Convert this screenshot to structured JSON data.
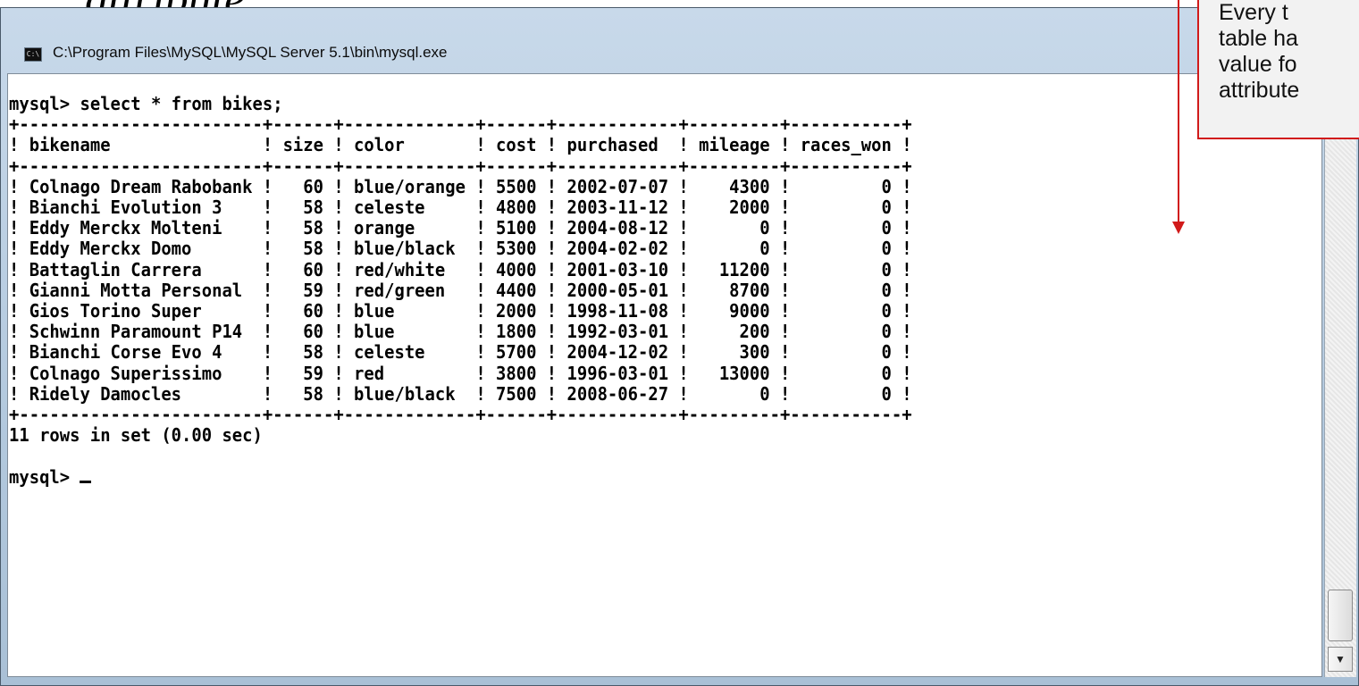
{
  "slide": {
    "title_fragment": "attribute."
  },
  "window": {
    "title": "C:\\Program Files\\MySQL\\MySQL Server 5.1\\bin\\mysql.exe",
    "icon": "console-icon",
    "minimize_icon": "minimize-icon"
  },
  "query": "mysql> select * from bikes;",
  "table": {
    "columns": [
      "bikename",
      "size",
      "color",
      "cost",
      "purchased",
      "mileage",
      "races_won"
    ],
    "rows": [
      [
        "Colnago Dream Rabobank",
        "60",
        "blue/orange",
        "5500",
        "2002-07-07",
        "4300",
        "0"
      ],
      [
        "Bianchi Evolution 3",
        "58",
        "celeste",
        "4800",
        "2003-11-12",
        "2000",
        "0"
      ],
      [
        "Eddy Merckx Molteni",
        "58",
        "orange",
        "5100",
        "2004-08-12",
        "0",
        "0"
      ],
      [
        "Eddy Merckx Domo",
        "58",
        "blue/black",
        "5300",
        "2004-02-02",
        "0",
        "0"
      ],
      [
        "Battaglin Carrera",
        "60",
        "red/white",
        "4000",
        "2001-03-10",
        "11200",
        "0"
      ],
      [
        "Gianni Motta Personal",
        "59",
        "red/green",
        "4400",
        "2000-05-01",
        "8700",
        "0"
      ],
      [
        "Gios Torino Super",
        "60",
        "blue",
        "2000",
        "1998-11-08",
        "9000",
        "0"
      ],
      [
        "Schwinn Paramount P14",
        "60",
        "blue",
        "1800",
        "1992-03-01",
        "200",
        "0"
      ],
      [
        "Bianchi Corse Evo 4",
        "58",
        "celeste",
        "5700",
        "2004-12-02",
        "300",
        "0"
      ],
      [
        "Colnago Superissimo",
        "59",
        "red",
        "3800",
        "1996-03-01",
        "13000",
        "0"
      ],
      [
        "Ridely Damocles",
        "58",
        "blue/black",
        "7500",
        "2008-06-27",
        "0",
        "0"
      ]
    ],
    "align": [
      "left",
      "right",
      "left",
      "left",
      "left",
      "right",
      "right"
    ]
  },
  "result_line": "11 rows in set (0.00 sec)",
  "prompt": "mysql> ",
  "callout": {
    "lines": [
      "Every t",
      "table ha",
      "value fo",
      "attribute"
    ],
    "border_color": "#d11a1a"
  },
  "scrollbar": {
    "down_arrow": "▼"
  }
}
